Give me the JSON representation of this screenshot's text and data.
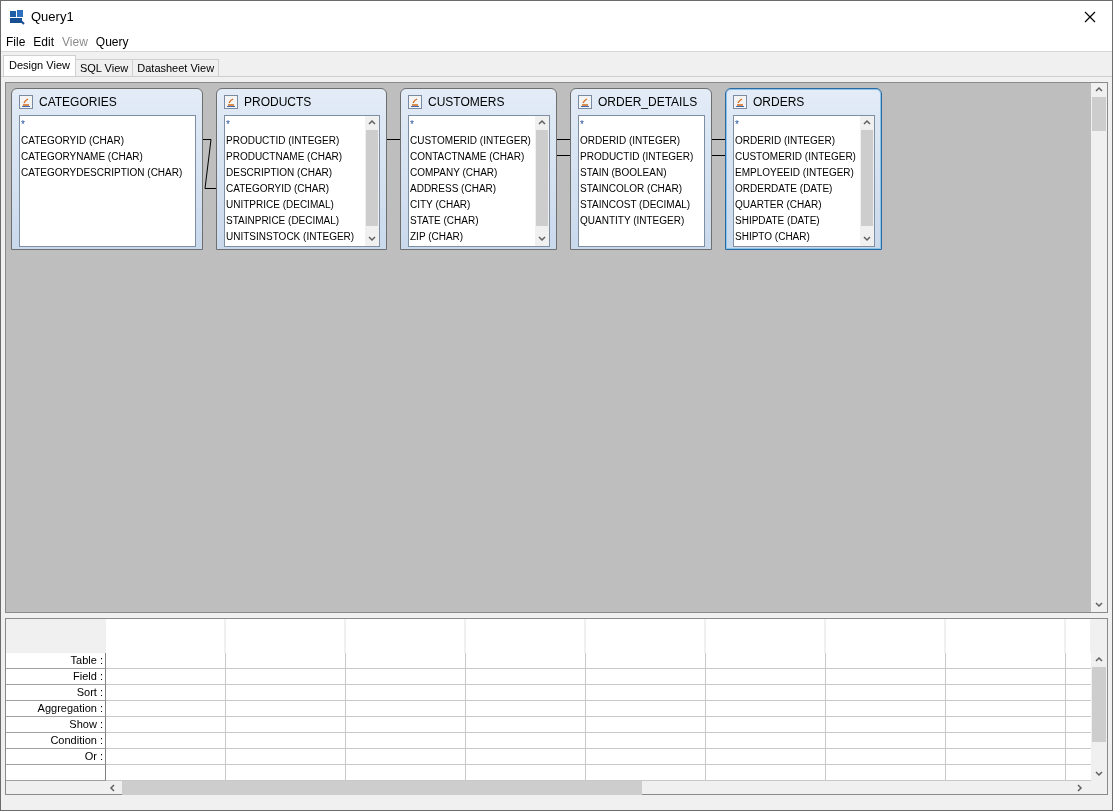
{
  "window": {
    "title": "Query1"
  },
  "menu": [
    {
      "label": "File",
      "disabled": false
    },
    {
      "label": "Edit",
      "disabled": false
    },
    {
      "label": "View",
      "disabled": true
    },
    {
      "label": "Query",
      "disabled": false
    }
  ],
  "tabs": [
    {
      "label": "Design View",
      "selected": true
    },
    {
      "label": "SQL View",
      "selected": false
    },
    {
      "label": "Datasheet View",
      "selected": false
    }
  ],
  "tables": [
    {
      "name": "CATEGORIES",
      "selected": false,
      "scrollbar": false,
      "fields": [
        "*",
        "CATEGORYID (CHAR)",
        "CATEGORYNAME (CHAR)",
        "CATEGORYDESCRIPTION (CHAR)"
      ]
    },
    {
      "name": "PRODUCTS",
      "selected": false,
      "scrollbar": true,
      "fields": [
        "*",
        "PRODUCTID (INTEGER)",
        "PRODUCTNAME (CHAR)",
        "DESCRIPTION (CHAR)",
        "CATEGORYID (CHAR)",
        "UNITPRICE (DECIMAL)",
        "STAINPRICE (DECIMAL)",
        "UNITSINSTOCK (INTEGER)"
      ]
    },
    {
      "name": "CUSTOMERS",
      "selected": false,
      "scrollbar": true,
      "fields": [
        "*",
        "CUSTOMERID (INTEGER)",
        "CONTACTNAME (CHAR)",
        "COMPANY (CHAR)",
        "ADDRESS (CHAR)",
        "CITY (CHAR)",
        "STATE (CHAR)",
        "ZIP (CHAR)"
      ]
    },
    {
      "name": "ORDER_DETAILS",
      "selected": false,
      "scrollbar": false,
      "fields": [
        "*",
        "ORDERID (INTEGER)",
        "PRODUCTID (INTEGER)",
        "STAIN (BOOLEAN)",
        "STAINCOLOR (CHAR)",
        "STAINCOST (DECIMAL)",
        "QUANTITY (INTEGER)"
      ]
    },
    {
      "name": "ORDERS",
      "selected": true,
      "scrollbar": true,
      "fields": [
        "*",
        "ORDERID (INTEGER)",
        "CUSTOMERID (INTEGER)",
        "EMPLOYEEID (INTEGER)",
        "ORDERDATE (DATE)",
        "QUARTER (CHAR)",
        "SHIPDATE (DATE)",
        "SHIPTO (CHAR)"
      ]
    }
  ],
  "grid": {
    "rows": [
      "Table :",
      "Field :",
      "Sort :",
      "Aggregation :",
      "Show :",
      "Condition :",
      "Or :"
    ]
  }
}
